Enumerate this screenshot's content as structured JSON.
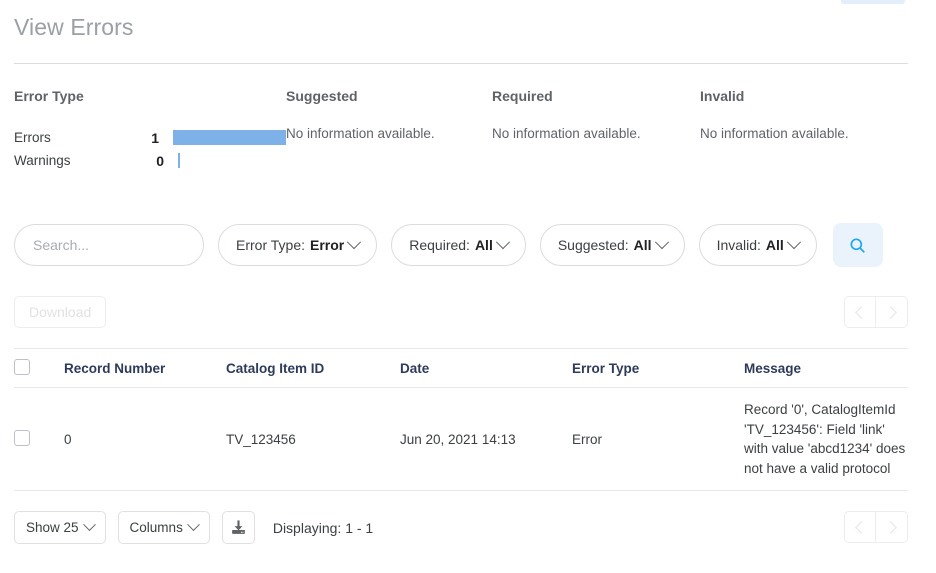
{
  "page": {
    "title": "View Errors"
  },
  "summary": {
    "columns": [
      {
        "heading": "Error Type"
      },
      {
        "heading": "Suggested",
        "note": "No information available."
      },
      {
        "heading": "Required",
        "note": "No information available."
      },
      {
        "heading": "Invalid",
        "note": "No information available."
      }
    ]
  },
  "chart_data": {
    "type": "bar",
    "title": "Error Type",
    "orientation": "horizontal",
    "categories": [
      "Errors",
      "Warnings"
    ],
    "values": [
      1,
      0
    ],
    "value_labels": [
      "1",
      "0"
    ],
    "xlabel": "",
    "ylabel": "",
    "xlim": [
      0,
      1
    ],
    "grid": false,
    "legend": null,
    "bar_color": "#7eb1e8"
  },
  "filters": {
    "search": {
      "placeholder": "Search...",
      "value": ""
    },
    "pills": [
      {
        "label": "Error Type:",
        "value": "Error"
      },
      {
        "label": "Required:",
        "value": "All"
      },
      {
        "label": "Suggested:",
        "value": "All"
      },
      {
        "label": "Invalid:",
        "value": "All"
      }
    ],
    "search_button_icon": "search-icon",
    "search_button_color": "#1ba7f0"
  },
  "actions": {
    "download_label": "Download",
    "pager": {
      "prev_icon": "chevron-left-icon",
      "next_icon": "chevron-right-icon"
    }
  },
  "table": {
    "headers": [
      "Record Number",
      "Catalog Item ID",
      "Date",
      "Error Type",
      "Message"
    ],
    "rows": [
      {
        "record_number": "0",
        "catalog_item_id": "TV_123456",
        "date": "Jun 20, 2021 14:13",
        "error_type": "Error",
        "message": "Record '0', CatalogItemId 'TV_123456': Field 'link' with value 'abcd1234' does not have a valid protocol"
      }
    ]
  },
  "footer": {
    "show_label": "Show 25",
    "columns_label": "Columns",
    "export_icon": "download-icon",
    "displaying": "Displaying: 1 - 1"
  }
}
